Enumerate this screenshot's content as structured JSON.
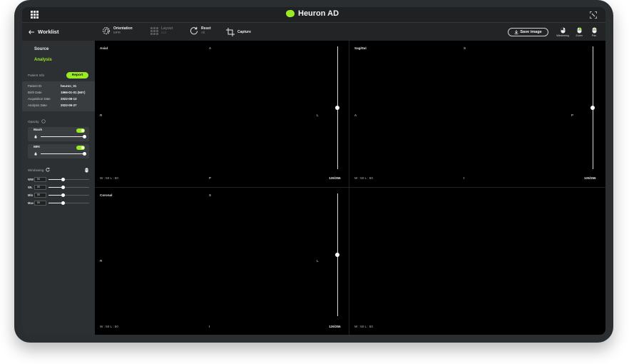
{
  "app": {
    "title": "Heuron AD"
  },
  "toolbar": {
    "back_label": "Worklist",
    "orientation": {
      "label": "Orientation",
      "value": "MPR"
    },
    "layout": {
      "label": "Layout",
      "value": "2x2"
    },
    "reset": {
      "label": "Reset",
      "value": "All"
    },
    "capture": {
      "label": "Capture"
    },
    "save_image": "Save image",
    "mouse_tools": [
      "Windowing",
      "Zoom",
      "Pan"
    ]
  },
  "sidebar": {
    "nav": [
      "Source",
      "Analysis"
    ],
    "patient_info_label": "Patient Info",
    "report_button": "Report",
    "patient": [
      {
        "key": "Patient ID",
        "value": "heuron_01"
      },
      {
        "key": "Birth Date",
        "value": "1966-01-01 (56Y)"
      },
      {
        "key": "Acquisition Date",
        "value": "2022-08-13"
      },
      {
        "key": "Analysis Date",
        "value": "2022-09-27"
      }
    ],
    "opacity_label": "Opacity",
    "layers": [
      {
        "name": "Mask",
        "enabled": true,
        "opacity": 1.0
      },
      {
        "name": "MRI",
        "enabled": true,
        "opacity": 1.0
      }
    ],
    "windowing_label": "Windowing",
    "windowing": [
      {
        "key": "WW",
        "value": "50",
        "level": 0.35
      },
      {
        "key": "WL",
        "value": "50",
        "level": 0.35
      },
      {
        "key": "Min",
        "value": "50",
        "level": 0.35
      },
      {
        "key": "Max",
        "value": "50",
        "level": 0.35
      }
    ]
  },
  "viewports": [
    {
      "title": "Axial",
      "top": "A",
      "bottom": "P",
      "left": "R",
      "right": "L",
      "wl": "W : 50   L : 50",
      "count": "126/255",
      "slice": 0.5
    },
    {
      "title": "Sagittal",
      "top": "S",
      "bottom": "I",
      "left": "A",
      "right": "P",
      "wl": "W : 50   L : 50",
      "count": "126/255",
      "slice": 0.5
    },
    {
      "title": "Coronal",
      "top": "S",
      "bottom": "I",
      "left": "R",
      "right": "L",
      "wl": "W : 50   L : 50",
      "count": "126/255",
      "slice": 0.5
    },
    {
      "title": "",
      "top": "",
      "bottom": "",
      "left": "",
      "right": "",
      "wl": "W : 50   L : 50",
      "count": "",
      "slice": null
    }
  ],
  "colors": {
    "accent": "#9bea26",
    "background": "#202224",
    "panel": "#2d3032"
  }
}
